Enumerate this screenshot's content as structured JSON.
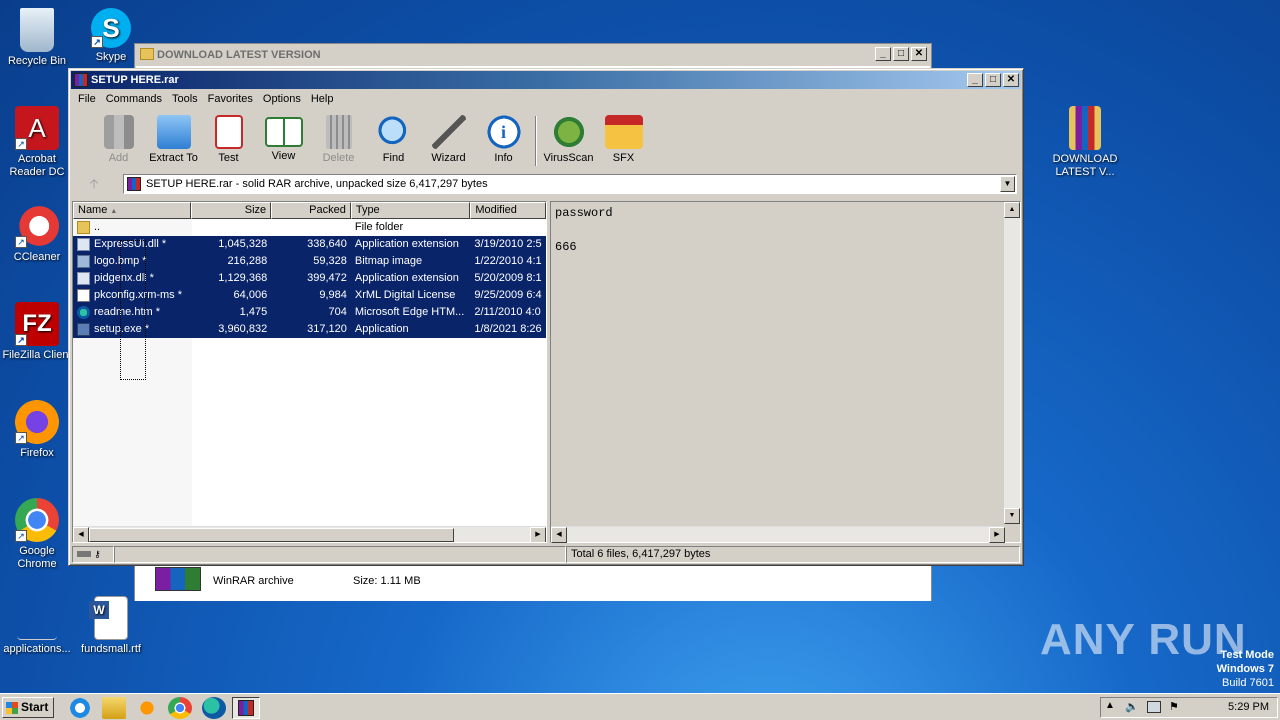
{
  "desktop": {
    "icons": [
      {
        "label": "Recycle Bin"
      },
      {
        "label": "Skype"
      },
      {
        "label": "Acrobat Reader DC"
      },
      {
        "label": "CCleaner"
      },
      {
        "label": "FileZilla Client"
      },
      {
        "label": "Firefox"
      },
      {
        "label": "Google Chrome"
      },
      {
        "label": "applications..."
      },
      {
        "label": "fundsmall.rtf"
      },
      {
        "label": "DOWNLOAD LATEST V..."
      }
    ],
    "watermark": "ANY RUN",
    "test_mode": {
      "line1": "Test Mode",
      "line2": "Windows 7",
      "line3": "Build 7601"
    }
  },
  "background_window": {
    "title": "DOWNLOAD LATEST VERSION",
    "item_type": "WinRAR archive",
    "item_size": "Size: 1.11 MB"
  },
  "winrar": {
    "title": "SETUP HERE.rar",
    "menu": [
      "File",
      "Commands",
      "Tools",
      "Favorites",
      "Options",
      "Help"
    ],
    "toolbar": [
      {
        "label": "Add",
        "icon": "add-icon",
        "disabled": true
      },
      {
        "label": "Extract To",
        "icon": "extract-folder-icon",
        "disabled": false
      },
      {
        "label": "Test",
        "icon": "test-clipboard-icon",
        "disabled": false
      },
      {
        "label": "View",
        "icon": "view-book-icon",
        "disabled": false
      },
      {
        "label": "Delete",
        "icon": "trash-icon",
        "disabled": true
      },
      {
        "label": "Find",
        "icon": "magnifier-icon",
        "disabled": false
      },
      {
        "label": "Wizard",
        "icon": "wand-icon",
        "disabled": false
      },
      {
        "label": "Info",
        "icon": "info-icon",
        "disabled": false
      },
      {
        "label": "VirusScan",
        "icon": "virus-scan-icon",
        "disabled": false
      },
      {
        "label": "SFX",
        "icon": "sfx-box-icon",
        "disabled": false
      }
    ],
    "address": "SETUP HERE.rar - solid RAR archive, unpacked size 6,417,297 bytes",
    "columns": {
      "name": "Name",
      "size": "Size",
      "packed": "Packed",
      "type": "Type",
      "modified": "Modified"
    },
    "rows": [
      {
        "name": "..",
        "size": "",
        "packed": "",
        "type": "File folder",
        "modified": "",
        "selected": false
      },
      {
        "name": "ExpressUI.dll *",
        "size": "1,045,328",
        "packed": "338,640",
        "type": "Application extension",
        "modified": "3/19/2010 2:5",
        "selected": true
      },
      {
        "name": "logo.bmp *",
        "size": "216,288",
        "packed": "59,328",
        "type": "Bitmap image",
        "modified": "1/22/2010 4:1",
        "selected": true
      },
      {
        "name": "pidgenx.dll *",
        "size": "1,129,368",
        "packed": "399,472",
        "type": "Application extension",
        "modified": "5/20/2009 8:1",
        "selected": true
      },
      {
        "name": "pkconfig.xrm-ms *",
        "size": "64,006",
        "packed": "9,984",
        "type": "XrML Digital License",
        "modified": "9/25/2009 6:4",
        "selected": true
      },
      {
        "name": "readme.htm *",
        "size": "1,475",
        "packed": "704",
        "type": "Microsoft Edge HTM...",
        "modified": "2/11/2010 4:0",
        "selected": true
      },
      {
        "name": "setup.exe *",
        "size": "3,960,832",
        "packed": "317,120",
        "type": "Application",
        "modified": "1/8/2021 8:26",
        "selected": true
      }
    ],
    "comment": "password\n\n666",
    "status_total": "Total 6 files, 6,417,297 bytes"
  },
  "taskbar": {
    "start_label": "Start",
    "clock": "5:29 PM"
  }
}
